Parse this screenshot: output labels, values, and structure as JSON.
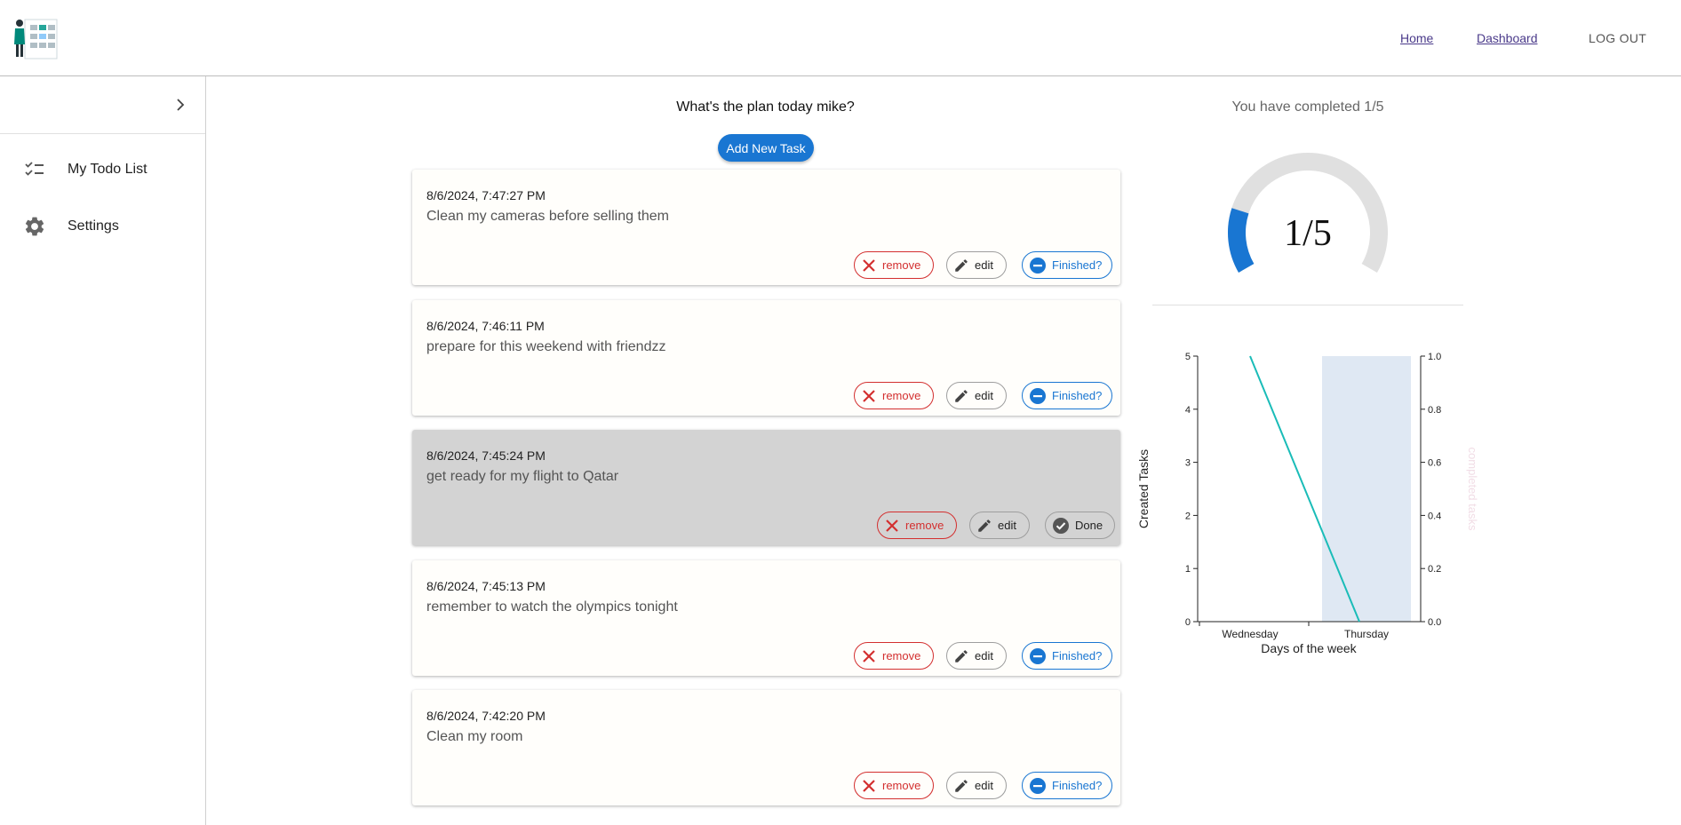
{
  "header": {
    "nav": {
      "home": "Home",
      "dashboard": "Dashboard",
      "logout": "LOG OUT"
    }
  },
  "sidebar": {
    "toggle_icon": "chevron-right-icon",
    "items": [
      {
        "label": "My Todo List",
        "icon": "checklist-icon"
      },
      {
        "label": "Settings",
        "icon": "gear-icon"
      }
    ]
  },
  "main": {
    "greeting": "What's the plan today mike?",
    "add_button": "Add New Task",
    "tasks": [
      {
        "timestamp": "8/6/2024, 7:47:27 PM",
        "text": "Clean my cameras before selling them",
        "remove": "remove",
        "edit": "edit",
        "status": "Finished?"
      },
      {
        "timestamp": "8/6/2024, 7:46:11 PM",
        "text": "prepare for this weekend with friendzz",
        "remove": "remove",
        "edit": "edit",
        "status": "Finished?"
      },
      {
        "timestamp": "8/6/2024, 7:45:24 PM",
        "text": "get ready for my flight to Qatar",
        "remove": "remove",
        "edit": "edit",
        "status": "Done"
      },
      {
        "timestamp": "8/6/2024, 7:45:13 PM",
        "text": "remember to watch the olympics tonight",
        "remove": "remove",
        "edit": "edit",
        "status": "Finished?"
      },
      {
        "timestamp": "8/6/2024, 7:42:20 PM",
        "text": "Clean my room",
        "remove": "remove",
        "edit": "edit",
        "status": "Finished?"
      }
    ]
  },
  "progress": {
    "heading": "You have completed 1/5",
    "gauge_label": "1/5",
    "completed": 1,
    "total": 5
  },
  "colors": {
    "primary": "#1976d2",
    "danger": "#d32f2f",
    "line": "#1abcb8",
    "bar": "#dfe8f3",
    "gauge_track": "#e0e0e0"
  },
  "chart_data": {
    "type": "line",
    "categories": [
      "Wednesday",
      "Thursday"
    ],
    "xlabel": "Days of the week",
    "ylabel": "Created Tasks",
    "y2label": "completed tasks",
    "ylim": [
      0,
      5
    ],
    "y2lim": [
      0,
      1
    ],
    "yticks": [
      "0",
      "1",
      "2",
      "3",
      "4",
      "5"
    ],
    "y2ticks": [
      "0.0",
      "0.2",
      "0.4",
      "0.6",
      "0.8",
      "1.0"
    ],
    "series": [
      {
        "axis": "left",
        "kind": "line",
        "values": [
          5,
          0
        ]
      },
      {
        "axis": "right",
        "kind": "bar",
        "values": [
          0,
          1
        ]
      }
    ]
  }
}
